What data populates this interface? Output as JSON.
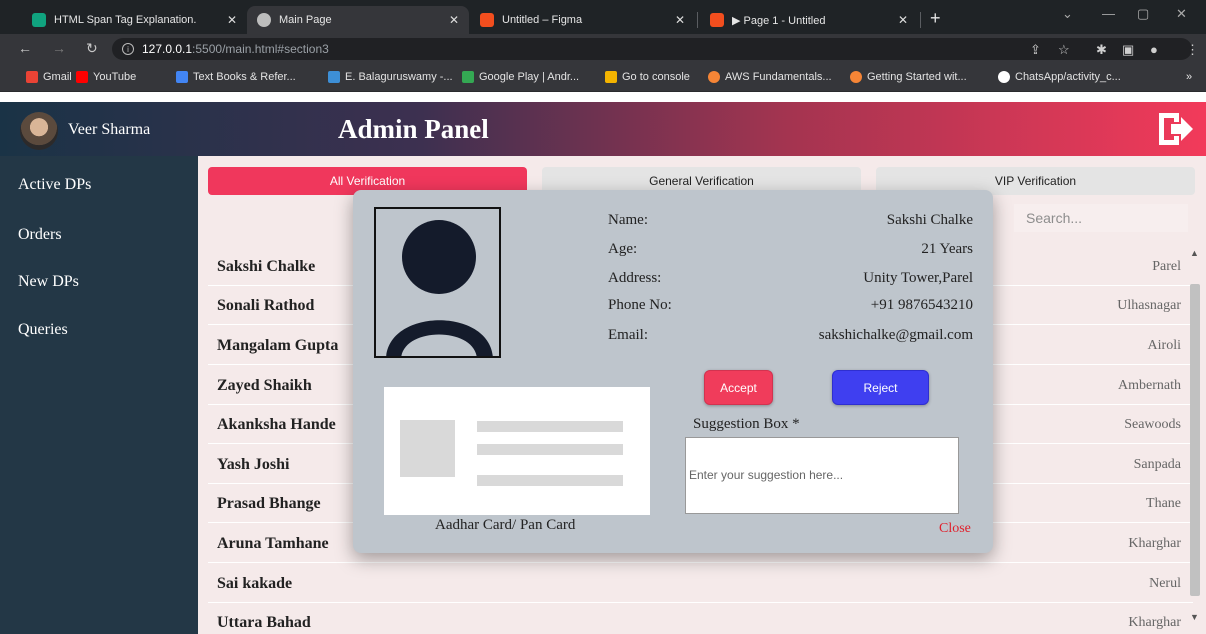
{
  "browser": {
    "tabs": [
      {
        "title": "HTML Span Tag Explanation.",
        "active": false,
        "favicon_color": "#10a37f"
      },
      {
        "title": "Main Page",
        "active": true,
        "favicon_color": "#bdbdbd"
      },
      {
        "title": "Untitled – Figma",
        "active": false,
        "favicon_color": "#f24e1e"
      },
      {
        "title": "▶ Page 1 - Untitled",
        "active": false,
        "favicon_color": "#f24e1e"
      }
    ],
    "url_host": "127.0.0.1",
    "url_path": ":5500/main.html#section3",
    "bookmarks": [
      {
        "label": "Gmail",
        "color": "#ea4335"
      },
      {
        "label": "YouTube",
        "color": "#ff0000"
      },
      {
        "label": "Text Books & Refer...",
        "color": "#4285f4"
      },
      {
        "label": "E. Balaguruswamy -...",
        "color": "#3d8fd6"
      },
      {
        "label": "Google Play | Andr...",
        "color": "#34a853"
      },
      {
        "label": "Go to console",
        "color": "#f4b400"
      },
      {
        "label": "AWS Fundamentals...",
        "color": "#f58536"
      },
      {
        "label": "Getting Started wit...",
        "color": "#f58536"
      },
      {
        "label": "ChatsApp/activity_c...",
        "color": "#ffffff"
      }
    ],
    "more_bookmarks": "»"
  },
  "header": {
    "user_name": "Veer Sharma",
    "title": "Admin Panel"
  },
  "sidebar": {
    "items": [
      {
        "label": "Active DPs"
      },
      {
        "label": "Orders"
      },
      {
        "label": "New DPs"
      },
      {
        "label": "Queries"
      }
    ]
  },
  "main": {
    "tabs": [
      {
        "label": "All Verification",
        "active": true
      },
      {
        "label": "General Verification",
        "active": false
      },
      {
        "label": "VIP Verification",
        "active": false
      }
    ],
    "search_placeholder": "Search...",
    "rows": [
      {
        "name": "Sakshi Chalke",
        "location": "Parel"
      },
      {
        "name": "Sonali Rathod",
        "location": "Ulhasnagar"
      },
      {
        "name": "Mangalam Gupta",
        "location": "Airoli"
      },
      {
        "name": "Zayed Shaikh",
        "location": "Ambernath"
      },
      {
        "name": "Akanksha Hande",
        "location": "Seawoods"
      },
      {
        "name": "Yash Joshi",
        "location": "Sanpada"
      },
      {
        "name": "Prasad Bhange",
        "location": "Thane"
      },
      {
        "name": "Aruna Tamhane",
        "location": "Kharghar"
      },
      {
        "name": "Sai kakade",
        "location": "Nerul"
      },
      {
        "name": "Uttara Bahad",
        "location": "Kharghar"
      }
    ]
  },
  "modal": {
    "details": [
      {
        "label": "Name:",
        "value": "Sakshi Chalke"
      },
      {
        "label": "Age:",
        "value": "21 Years"
      },
      {
        "label": "Address:",
        "value": "Unity Tower,Parel"
      },
      {
        "label": "Phone No:",
        "value": "+91 9876543210"
      },
      {
        "label": "Email:",
        "value": "sakshichalke@gmail.com"
      }
    ],
    "accept_label": "Accept",
    "reject_label": "Reject",
    "id_caption": "Aadhar Card/ Pan Card",
    "suggestion_label": "Suggestion Box *",
    "suggestion_placeholder": "Enter your suggestion here...",
    "close_label": "Close"
  },
  "colors": {
    "accent": "#f0375c",
    "reject": "#3f3ff0",
    "sidebar": "#233746",
    "close": "#e0202c"
  },
  "icons": {
    "logout": "logout-icon",
    "avatar": "avatar"
  }
}
